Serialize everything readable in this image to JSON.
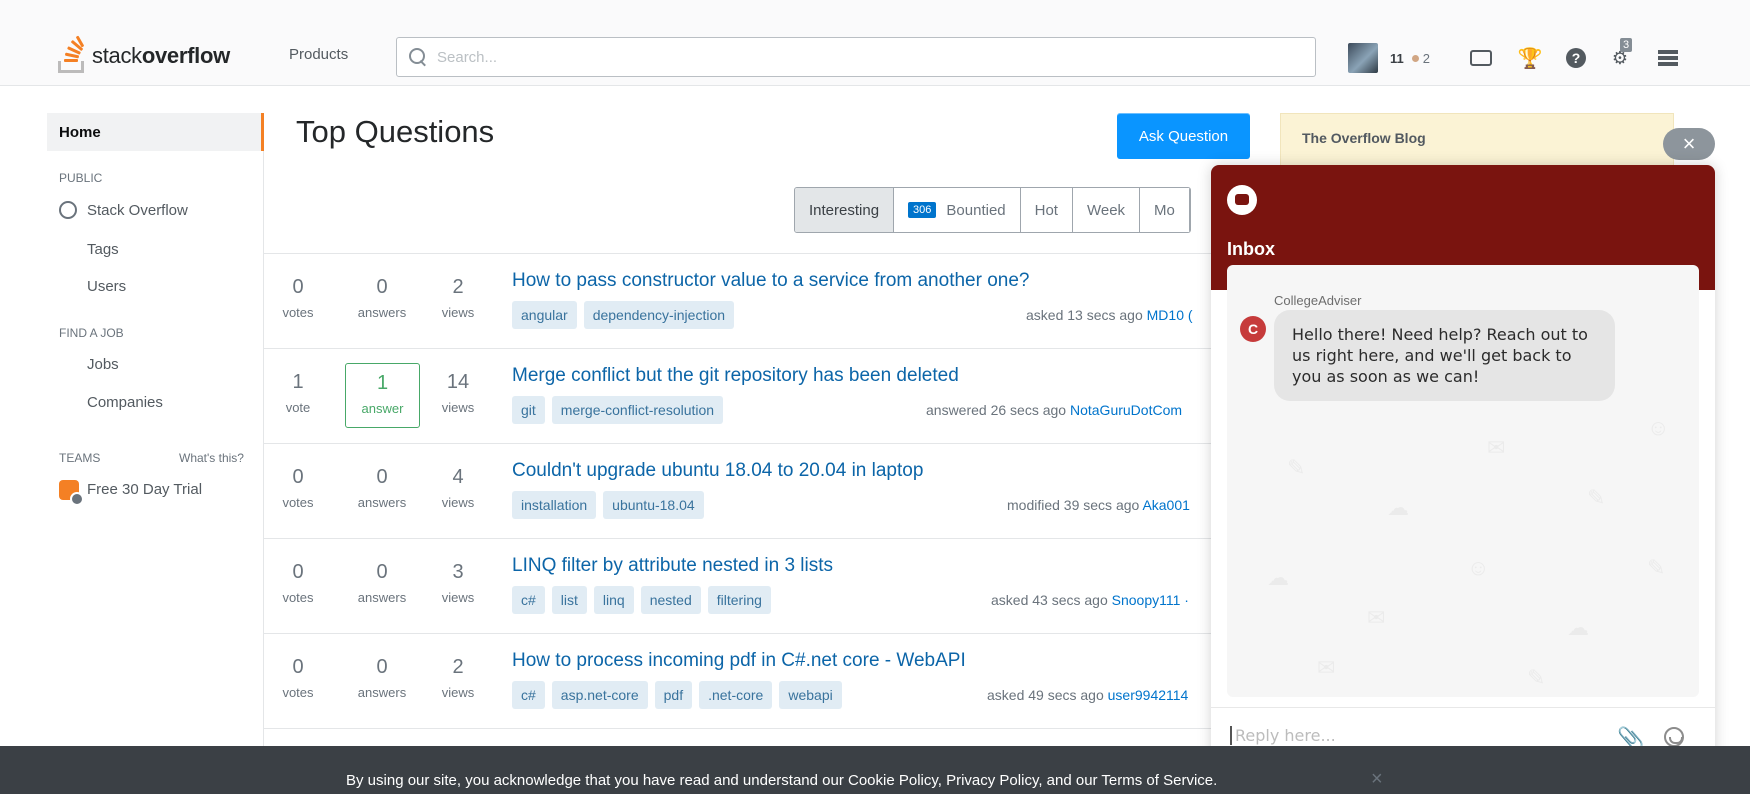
{
  "header": {
    "logo_light": "stack",
    "logo_bold": "overflow",
    "products_label": "Products",
    "search_placeholder": "Search...",
    "reputation": "11",
    "bronze_badges": "2",
    "review_count": "3",
    "icons": [
      "inbox-icon",
      "achievements-icon",
      "help-icon",
      "review-queue-icon",
      "site-switcher-icon"
    ]
  },
  "nav": {
    "home": "Home",
    "public_heading": "PUBLIC",
    "stack_overflow": "Stack Overflow",
    "tags": "Tags",
    "users": "Users",
    "find_job_heading": "FIND A JOB",
    "jobs": "Jobs",
    "companies": "Companies",
    "teams_heading": "TEAMS",
    "whats_this": "What's this?",
    "free_trial": "Free 30 Day Trial"
  },
  "main": {
    "title": "Top Questions",
    "ask_button": "Ask Question",
    "filters": [
      {
        "label": "Interesting",
        "active": true
      },
      {
        "label": "Bountied",
        "count": "306",
        "active": false
      },
      {
        "label": "Hot",
        "active": false
      },
      {
        "label": "Week",
        "active": false
      },
      {
        "label": "Mo",
        "active": false
      }
    ],
    "questions": [
      {
        "votes": "0",
        "votes_label": "votes",
        "answers": "0",
        "answers_label": "answers",
        "views": "2",
        "views_label": "views",
        "title": "How to pass constructor value to a service from another one?",
        "tags": [
          "angular",
          "dependency-injection"
        ],
        "meta": "asked 13 secs ago",
        "user": "MD10 (",
        "answered": false
      },
      {
        "votes": "1",
        "votes_label": "vote",
        "answers": "1",
        "answers_label": "answer",
        "views": "14",
        "views_label": "views",
        "title": "Merge conflict but the git repository has been deleted",
        "tags": [
          "git",
          "merge-conflict-resolution"
        ],
        "meta": "answered 26 secs ago",
        "user": "NotaGuruDotCom",
        "answered": true
      },
      {
        "votes": "0",
        "votes_label": "votes",
        "answers": "0",
        "answers_label": "answers",
        "views": "4",
        "views_label": "views",
        "title": "Couldn't upgrade ubuntu 18.04 to 20.04 in laptop",
        "tags": [
          "installation",
          "ubuntu-18.04"
        ],
        "meta": "modified 39 secs ago",
        "user": "Aka001",
        "answered": false
      },
      {
        "votes": "0",
        "votes_label": "votes",
        "answers": "0",
        "answers_label": "answers",
        "views": "3",
        "views_label": "views",
        "title": "LINQ filter by attribute nested in 3 lists",
        "tags": [
          "c#",
          "list",
          "linq",
          "nested",
          "filtering"
        ],
        "meta": "asked 43 secs ago",
        "user": "Snoopy111 ·",
        "answered": false
      },
      {
        "votes": "0",
        "votes_label": "votes",
        "answers": "0",
        "answers_label": "answers",
        "views": "2",
        "views_label": "views",
        "title": "How to process incoming pdf in C#.net core - WebAPI",
        "tags": [
          "c#",
          "asp.net-core",
          "pdf",
          ".net-core",
          "webapi"
        ],
        "meta": "asked 49 secs ago",
        "user": "user9942114",
        "answered": false
      }
    ]
  },
  "sidebar": {
    "blog_heading": "The Overflow Blog"
  },
  "chat": {
    "close": "×",
    "title": "Inbox",
    "sender": "CollegeAdviser",
    "avatar_letter": "C",
    "message": "Hello there! Need help? Reach out to us right here, and we'll get back to you as soon as we can!",
    "reply_placeholder": "Reply here...",
    "header_color": "#7a140f"
  },
  "cookie": {
    "text": "By using our site, you acknowledge that you have read and understand our Cookie Policy, Privacy Policy, and our Terms of Service.",
    "close": "×"
  },
  "colors": {
    "accent": "#f48024",
    "link": "#0c65a8",
    "button": "#0a95ff"
  }
}
